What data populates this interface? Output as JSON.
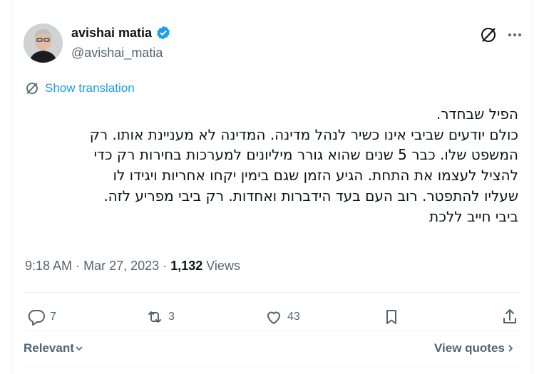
{
  "author": {
    "name": "avishai matia",
    "handle": "@avishai_matia"
  },
  "translate_label": "Show translation",
  "tweet_lines": [
    "הפיל שבחדר.",
    "כולם יודעים שביבי אינו כשיר לנהל מדינה. המדינה לא מעניינת אותו. רק",
    "המשפט שלו. כבר 5 שנים שהוא גורר מיליונים למערכות בחירות רק כדי",
    "להציל לעצמו את התחת. הגיע הזמן שגם בימין יקחו אחריות ויגידו לו",
    "שעליו להתפטר. רוב העם בעד הידברות ואחדות. רק ביבי מפריע לזה.",
    "ביבי חייב ללכת"
  ],
  "meta": {
    "time": "9:18 AM",
    "separator": "·",
    "date": "Mar 27, 2023",
    "views_count": "1,132",
    "views_label": "Views"
  },
  "actions": {
    "replies": "7",
    "retweets": "3",
    "likes": "43"
  },
  "footer": {
    "relevant_label": "Relevant",
    "view_quotes_label": "View quotes"
  },
  "colors": {
    "accent": "#1d9bf0",
    "muted": "#536471",
    "text": "#0f1419"
  },
  "icons": [
    "verified-badge-icon",
    "grok-icon",
    "more-icon",
    "translate-icon",
    "reply-icon",
    "retweet-icon",
    "like-icon",
    "bookmark-icon",
    "share-icon",
    "chevron-down-icon",
    "chevron-right-icon"
  ]
}
